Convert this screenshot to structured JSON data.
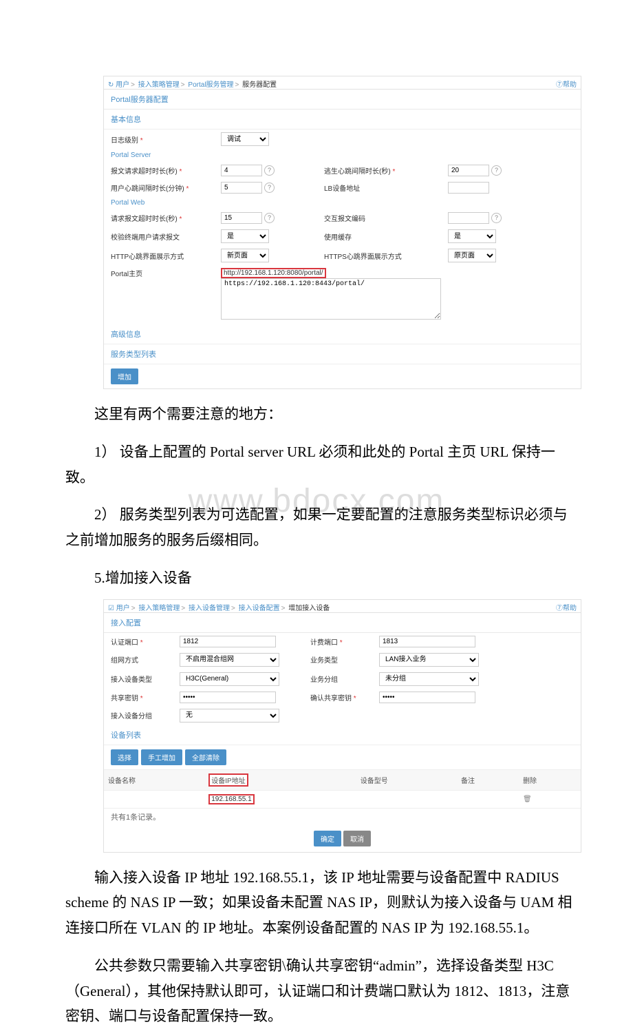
{
  "panel1": {
    "bcIcon": "↻",
    "bc1": "用户",
    "bc2": "接入策略管理",
    "bc3": "Portal服务管理",
    "bc4": "服务器配置",
    "help": "⑦帮助",
    "tab": "Portal服务器配置",
    "sec_basic": "基本信息",
    "log_label": "日志级别",
    "log_value": "调试",
    "portal_server": "Portal Server",
    "req_timeout_label": "报文请求超时时长(秒)",
    "req_timeout_val": "4",
    "escape_hb_label": "逃生心跳间隔时长(秒)",
    "escape_hb_val": "20",
    "user_hb_label": "用户心跳间隔时长(分钟)",
    "user_hb_val": "5",
    "lb_label": "LB设备地址",
    "portal_web": "Portal Web",
    "req_pkt_timeout_label": "请求报文超时时长(秒)",
    "req_pkt_timeout_val": "15",
    "pkt_encoding_label": "交互报文编码",
    "validate_label": "校验终端用户请求报文",
    "validate_val": "是",
    "use_cache_label": "使用缓存",
    "use_cache_val": "是",
    "http_hb_label": "HTTP心跳界面展示方式",
    "http_hb_val": "新页面",
    "https_hb_label": "HTTPS心跳界面展示方式",
    "https_hb_val": "原页面",
    "portal_home_label": "Portal主页",
    "portal_home_line1": "http://192.168.1.120:8080/portal/",
    "portal_home_line2": "https://192.168.1.120:8443/portal/",
    "sec_adv": "高级信息",
    "svc_list": "服务类型列表",
    "add_btn": "增加"
  },
  "text": {
    "p1": "这里有两个需要注意的地方：",
    "p2": "1） 设备上配置的 Portal server URL 必须和此处的 Portal 主页 URL 保持一致。",
    "p3": "2） 服务类型列表为可选配置，如果一定要配置的注意服务类型标识必须与之前增加服务的服务后缀相同。",
    "p4": "5.增加接入设备",
    "p5": "输入接入设备 IP 地址 192.168.55.1，该 IP 地址需要与设备配置中 RADIUS scheme 的 NAS IP 一致；如果设备未配置 NAS IP，则默认为接入设备与 UAM 相连接口所在 VLAN 的 IP 地址。本案例设备配置的 NAS IP 为 192.168.55.1。",
    "p6": "公共参数只需要输入共享密钥\\确认共享密钥“admin”，选择设备类型 H3C（General），其他保持默认即可，认证端口和计费端口默认为 1812、1813，注意密钥、端口与设备配置保持一致。"
  },
  "panel2": {
    "bcIcon": "☑",
    "bc1": "用户",
    "bc2": "接入策略管理",
    "bc3": "接入设备管理",
    "bc4": "接入设备配置",
    "bc5": "增加接入设备",
    "help": "⑦帮助",
    "tab": "接入配置",
    "auth_port_label": "认证端口",
    "auth_port_val": "1812",
    "acct_port_label": "计费端口",
    "acct_port_val": "1813",
    "team_label": "组网方式",
    "team_val": "不启用混合组网",
    "svc_type_label": "业务类型",
    "svc_type_val": "LAN接入业务",
    "dev_type_label": "接入设备类型",
    "dev_type_val": "H3C(General)",
    "svc_group_label": "业务分组",
    "svc_group_val": "未分组",
    "key_label": "共享密钥",
    "key_val": "•••••",
    "key2_label": "确认共享密钥",
    "key2_val": "•••••",
    "dev_group_label": "接入设备分组",
    "dev_group_val": "无",
    "sec_devlist": "设备列表",
    "btn_select": "选择",
    "btn_manual": "手工增加",
    "btn_clear": "全部清除",
    "col_name": "设备名称",
    "col_ip": "设备IP地址",
    "col_model": "设备型号",
    "col_remark": "备注",
    "col_del": "删除",
    "row_ip": "192.168.55.1",
    "trash": "🗑",
    "count": "共有1条记录。",
    "ok": "确定",
    "cancel": "取消"
  },
  "watermark": "www.bdocx.com"
}
